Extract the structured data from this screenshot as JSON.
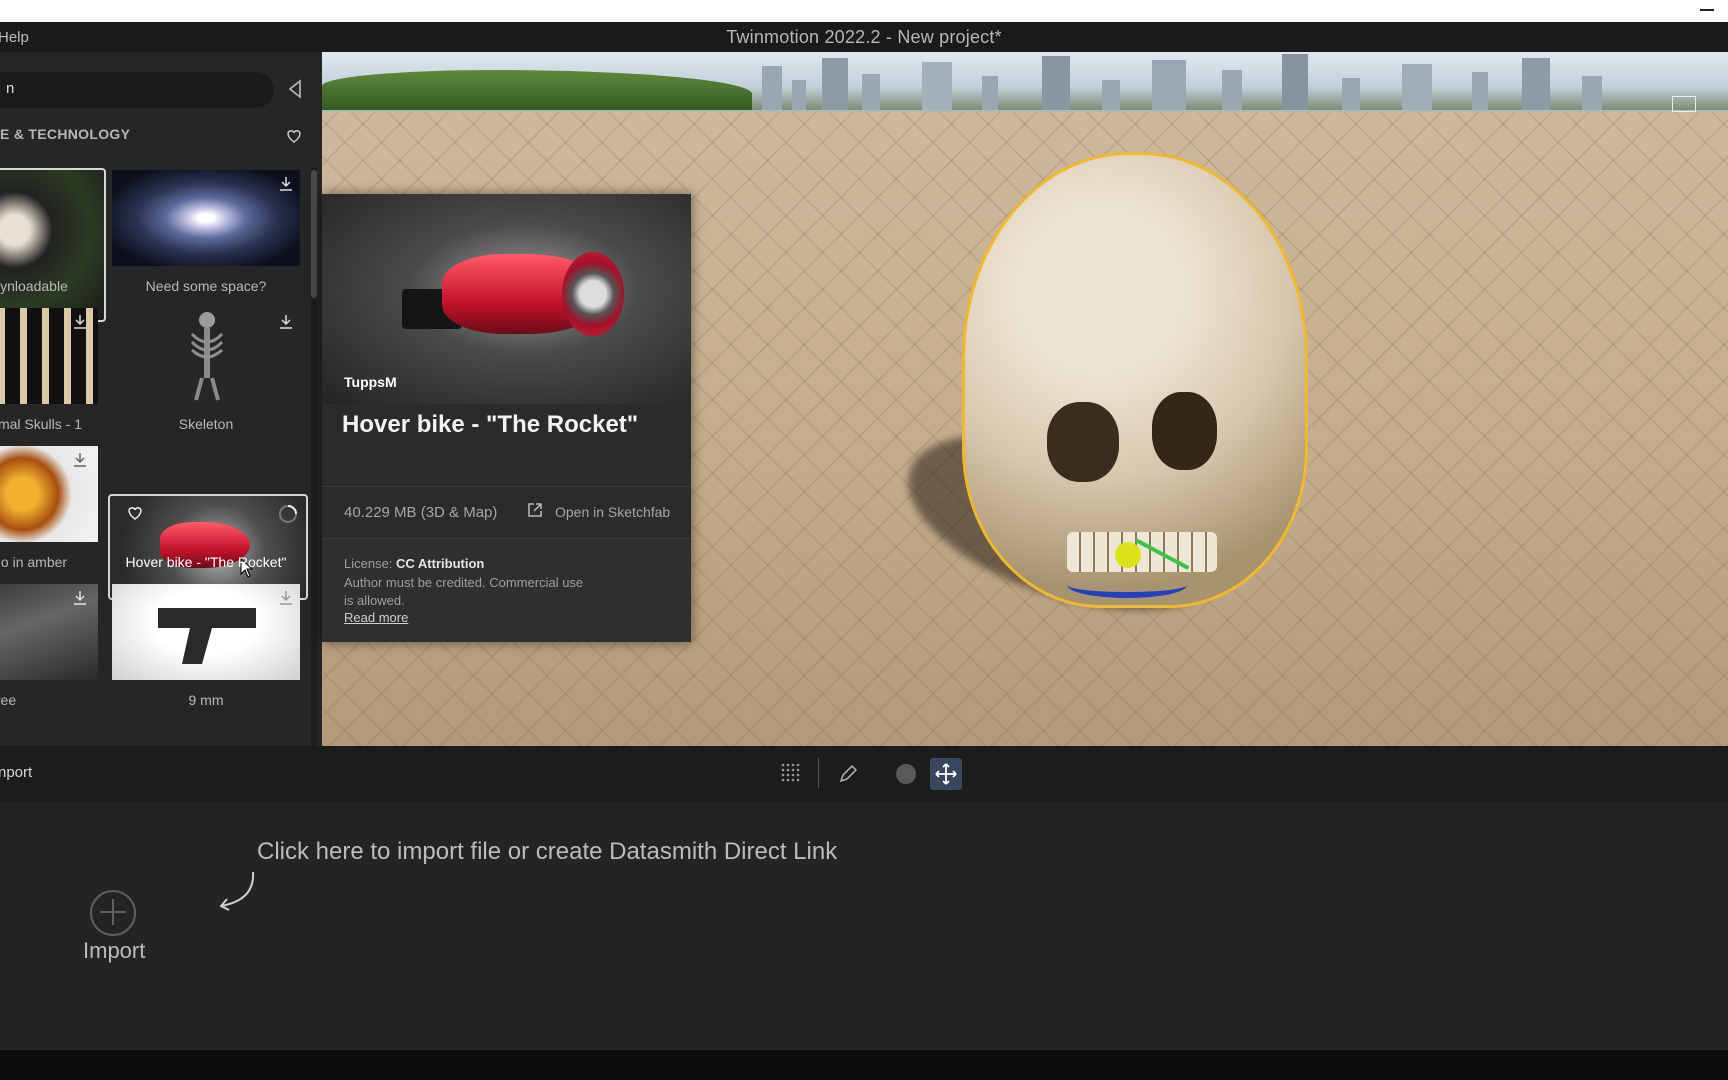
{
  "window": {
    "title": "Twinmotion 2022.2 - New project*",
    "menu_help": "Help"
  },
  "library": {
    "search_value": "n",
    "category_title": "E & TECHNOLOGY",
    "tiles": [
      {
        "label": "ynloadable"
      },
      {
        "label": "Need some space?"
      },
      {
        "label": "mal Skulls - 1"
      },
      {
        "label": "Skeleton"
      },
      {
        "label": "o in amber"
      },
      {
        "label": "Hover bike - \"The Rocket\""
      },
      {
        "label": "ree"
      },
      {
        "label": "9 mm"
      }
    ]
  },
  "asset_card": {
    "author": "TuppsM",
    "title": "Hover bike - \"The Rocket\"",
    "size": "40.229 MB (3D & Map)",
    "open_link": "Open in Sketchfab",
    "license_label": "License:",
    "license_value": "CC Attribution",
    "license_desc": "Author must be credited. Commercial use is allowed.",
    "read_more": "Read more"
  },
  "toolbar": {
    "import_tab": "nport",
    "active_tool": "move"
  },
  "import_area": {
    "hint": "Click here to import file or create Datasmith Direct Link",
    "import_label": "Import"
  },
  "colors": {
    "accent_outline": "#f0b830",
    "active_tool_bg": "#38475e",
    "panel_bg": "#262626"
  }
}
